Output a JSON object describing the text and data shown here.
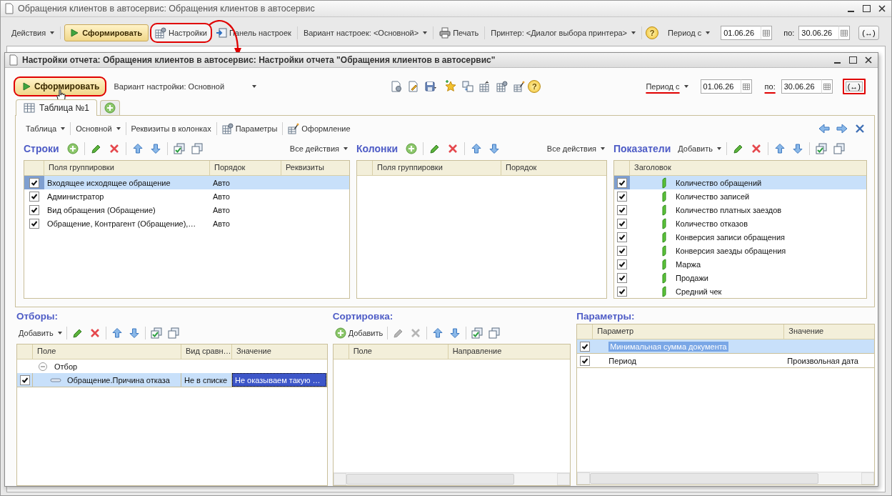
{
  "window": {
    "title": "Обращения клиентов в автосервис: Обращения клиентов в автосервис"
  },
  "main_toolbar": [
    {
      "kind": "menu",
      "label": "Действия"
    },
    {
      "kind": "sep"
    },
    {
      "kind": "primary",
      "label": "Сформировать"
    },
    {
      "kind": "settings",
      "label": "Настройки",
      "highlighted": true
    },
    {
      "kind": "panel",
      "label": "Панель настроек"
    },
    {
      "kind": "sep"
    },
    {
      "kind": "menu",
      "label": "Вариант настроек: <Основной>"
    },
    {
      "kind": "sep"
    },
    {
      "kind": "print",
      "label": "Печать"
    },
    {
      "kind": "sep"
    },
    {
      "kind": "menu",
      "label": "Принтер: <Диалог выбора принтера>"
    },
    {
      "kind": "sep"
    },
    {
      "kind": "help",
      "label": "?"
    }
  ],
  "main_period": {
    "label": "Период с",
    "underlined": false,
    "from": "01.06.26",
    "to_label": "по:",
    "to": "30.06.26",
    "swap": "(↔)",
    "swap_highlighted": false
  },
  "dialog": {
    "title": "Настройки отчета: Обращения клиентов в автосервис: Настройки отчета \"Обращения клиентов в автосервис\"",
    "generate": {
      "label": "Сформировать",
      "highlighted": true
    },
    "variant": "Вариант настройки: Основной",
    "icons": [
      {
        "kind": "gear-doc"
      },
      {
        "kind": "doc-edit"
      },
      {
        "kind": "save-menu"
      },
      {
        "kind": "star"
      },
      {
        "kind": "transfer"
      },
      {
        "kind": "formula"
      },
      {
        "kind": "grid-gear"
      },
      {
        "kind": "design"
      },
      {
        "kind": "help",
        "label": "?"
      }
    ],
    "period": {
      "label": "Период с",
      "underlined": true,
      "from": "01.06.26",
      "to_label": "по:",
      "to": "30.06.26",
      "swap": "(↔)",
      "swap_highlighted": true
    }
  },
  "tabs": [
    {
      "label": "Таблица №1",
      "selected": true
    }
  ],
  "sub_toolbar": [
    {
      "kind": "menu",
      "label": "Таблица"
    },
    {
      "kind": "sep"
    },
    {
      "kind": "menu",
      "label": "Основной"
    },
    {
      "kind": "sep"
    },
    {
      "kind": "text",
      "label": "Реквизиты в колонках"
    },
    {
      "kind": "sep"
    },
    {
      "kind": "params",
      "label": "Параметры"
    },
    {
      "kind": "sep"
    },
    {
      "kind": "design-text",
      "label": "Оформление"
    }
  ],
  "sub_toolbar_right": [
    {
      "kind": "nav-back"
    },
    {
      "kind": "nav-forward"
    },
    {
      "kind": "close"
    }
  ],
  "rows_panel": {
    "title": "Строки",
    "all_actions": "Все действия",
    "toolbar": [
      {
        "kind": "add"
      },
      {
        "kind": "sep"
      },
      {
        "kind": "edit"
      },
      {
        "kind": "delete"
      },
      {
        "kind": "sep"
      },
      {
        "kind": "up"
      },
      {
        "kind": "down"
      },
      {
        "kind": "sep"
      },
      {
        "kind": "check-all"
      },
      {
        "kind": "uncheck-all"
      }
    ],
    "columns": [
      "Поля группировки",
      "Порядок",
      "Реквизиты"
    ],
    "rows": [
      {
        "checked": true,
        "selected": true,
        "cells": [
          "Входящее исходящее обращение",
          "Авто"
        ]
      },
      {
        "checked": true,
        "selected": false,
        "cells": [
          "Администратор",
          "Авто"
        ]
      },
      {
        "checked": true,
        "selected": false,
        "cells": [
          "Вид обращения (Обращение)",
          "Авто"
        ]
      },
      {
        "checked": true,
        "selected": false,
        "cells": [
          "Обращение, Контрагент (Обращение),…",
          "Авто"
        ]
      }
    ]
  },
  "columns_panel": {
    "title": "Колонки",
    "all_actions": "Все действия",
    "toolbar": [
      {
        "kind": "add"
      },
      {
        "kind": "sep"
      },
      {
        "kind": "edit"
      },
      {
        "kind": "delete"
      },
      {
        "kind": "sep"
      },
      {
        "kind": "up"
      },
      {
        "kind": "down"
      }
    ],
    "columns": [
      "Поля группировки",
      "Порядок"
    ]
  },
  "indicators_panel": {
    "title": "Показатели",
    "toolbar": [
      {
        "kind": "menu",
        "label": "Добавить"
      },
      {
        "kind": "sep"
      },
      {
        "kind": "edit"
      },
      {
        "kind": "delete"
      },
      {
        "kind": "sep"
      },
      {
        "kind": "up"
      },
      {
        "kind": "down"
      },
      {
        "kind": "sep"
      },
      {
        "kind": "check-all"
      },
      {
        "kind": "uncheck-all"
      }
    ],
    "columns": [
      "Заголовок"
    ],
    "rows": [
      {
        "checked": true,
        "selected": true,
        "label": "Количество обращений"
      },
      {
        "checked": true,
        "selected": false,
        "label": "Количество записей"
      },
      {
        "checked": true,
        "selected": false,
        "label": "Количество платных заездов"
      },
      {
        "checked": true,
        "selected": false,
        "label": "Количество отказов"
      },
      {
        "checked": true,
        "selected": false,
        "label": "Конверсия записи обращения"
      },
      {
        "checked": true,
        "selected": false,
        "label": "Конверсия заезды обращения"
      },
      {
        "checked": true,
        "selected": false,
        "label": "Маржа"
      },
      {
        "checked": true,
        "selected": false,
        "label": "Продажи"
      },
      {
        "checked": true,
        "selected": false,
        "label": "Средний чек"
      }
    ]
  },
  "filters": {
    "title": "Отборы:",
    "toolbar": [
      {
        "kind": "menu",
        "label": "Добавить"
      },
      {
        "kind": "sep"
      },
      {
        "kind": "edit"
      },
      {
        "kind": "delete"
      },
      {
        "kind": "sep"
      },
      {
        "kind": "up"
      },
      {
        "kind": "down"
      },
      {
        "kind": "sep"
      },
      {
        "kind": "check-all"
      },
      {
        "kind": "uncheck-all"
      }
    ],
    "columns": [
      "Поле",
      "Вид сравн…",
      "Значение"
    ],
    "tree": [
      {
        "label": "Отбор",
        "expanded": true,
        "children": [
          {
            "checked": true,
            "selected": true,
            "cells": [
              {
                "text": "Обращение.Причина отказа",
                "focused": false
              },
              {
                "text": "Не в списке",
                "focused": false
              },
              {
                "text": "Не оказываем такую …",
                "focused": true
              }
            ]
          }
        ]
      }
    ]
  },
  "sorting": {
    "title": "Сортировка:",
    "toolbar": [
      {
        "kind": "add-text",
        "label": "Добавить"
      },
      {
        "kind": "sep"
      },
      {
        "kind": "edit",
        "disabled": true
      },
      {
        "kind": "delete",
        "disabled": true
      },
      {
        "kind": "sep"
      },
      {
        "kind": "up"
      },
      {
        "kind": "down"
      },
      {
        "kind": "sep"
      },
      {
        "kind": "check-all"
      },
      {
        "kind": "uncheck-all"
      }
    ],
    "columns": [
      "Поле",
      "Направление"
    ]
  },
  "parameters": {
    "title": "Параметры:",
    "columns": [
      "Параметр",
      "Значение"
    ],
    "rows": [
      {
        "checked": true,
        "selected": true,
        "editing": true,
        "cells": [
          "Минимальная сумма документа"
        ]
      },
      {
        "checked": true,
        "selected": false,
        "editing": false,
        "cells": [
          "Период",
          "Произвольная дата"
        ]
      }
    ]
  }
}
